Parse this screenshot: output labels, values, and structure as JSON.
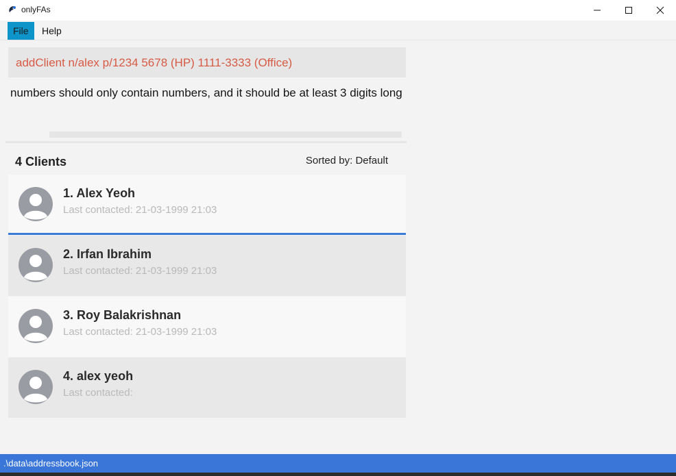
{
  "window": {
    "title": "onlyFAs",
    "minimize_glyph": "minimize-icon",
    "maximize_glyph": "maximize-icon",
    "close_glyph": "close-icon"
  },
  "menu": {
    "file": "File",
    "help": "Help"
  },
  "command": {
    "text": "addClient n/alex p/1234 5678 (HP) 1111-3333 (Office)",
    "color": "#d75a44"
  },
  "result": {
    "message": "numbers should only contain numbers, and it should be at least 3 digits long"
  },
  "client_list": {
    "count_label": "4 Clients",
    "sorted_label": "Sorted by: Default",
    "clients": [
      {
        "index_name": "1.  Alex Yeoh",
        "contact": "Last contacted: 21-03-1999 21:03"
      },
      {
        "index_name": "2.  Irfan Ibrahim",
        "contact": "Last contacted: 21-03-1999 21:03"
      },
      {
        "index_name": "3.  Roy Balakrishnan",
        "contact": "Last contacted: 21-03-1999 21:03"
      },
      {
        "index_name": "4.  alex yeoh",
        "contact": "Last contacted: "
      }
    ]
  },
  "status": {
    "path": ".\\data\\addressbook.json"
  },
  "colors": {
    "accent": "#3a76d8",
    "menu_active": "#0f94c9"
  }
}
